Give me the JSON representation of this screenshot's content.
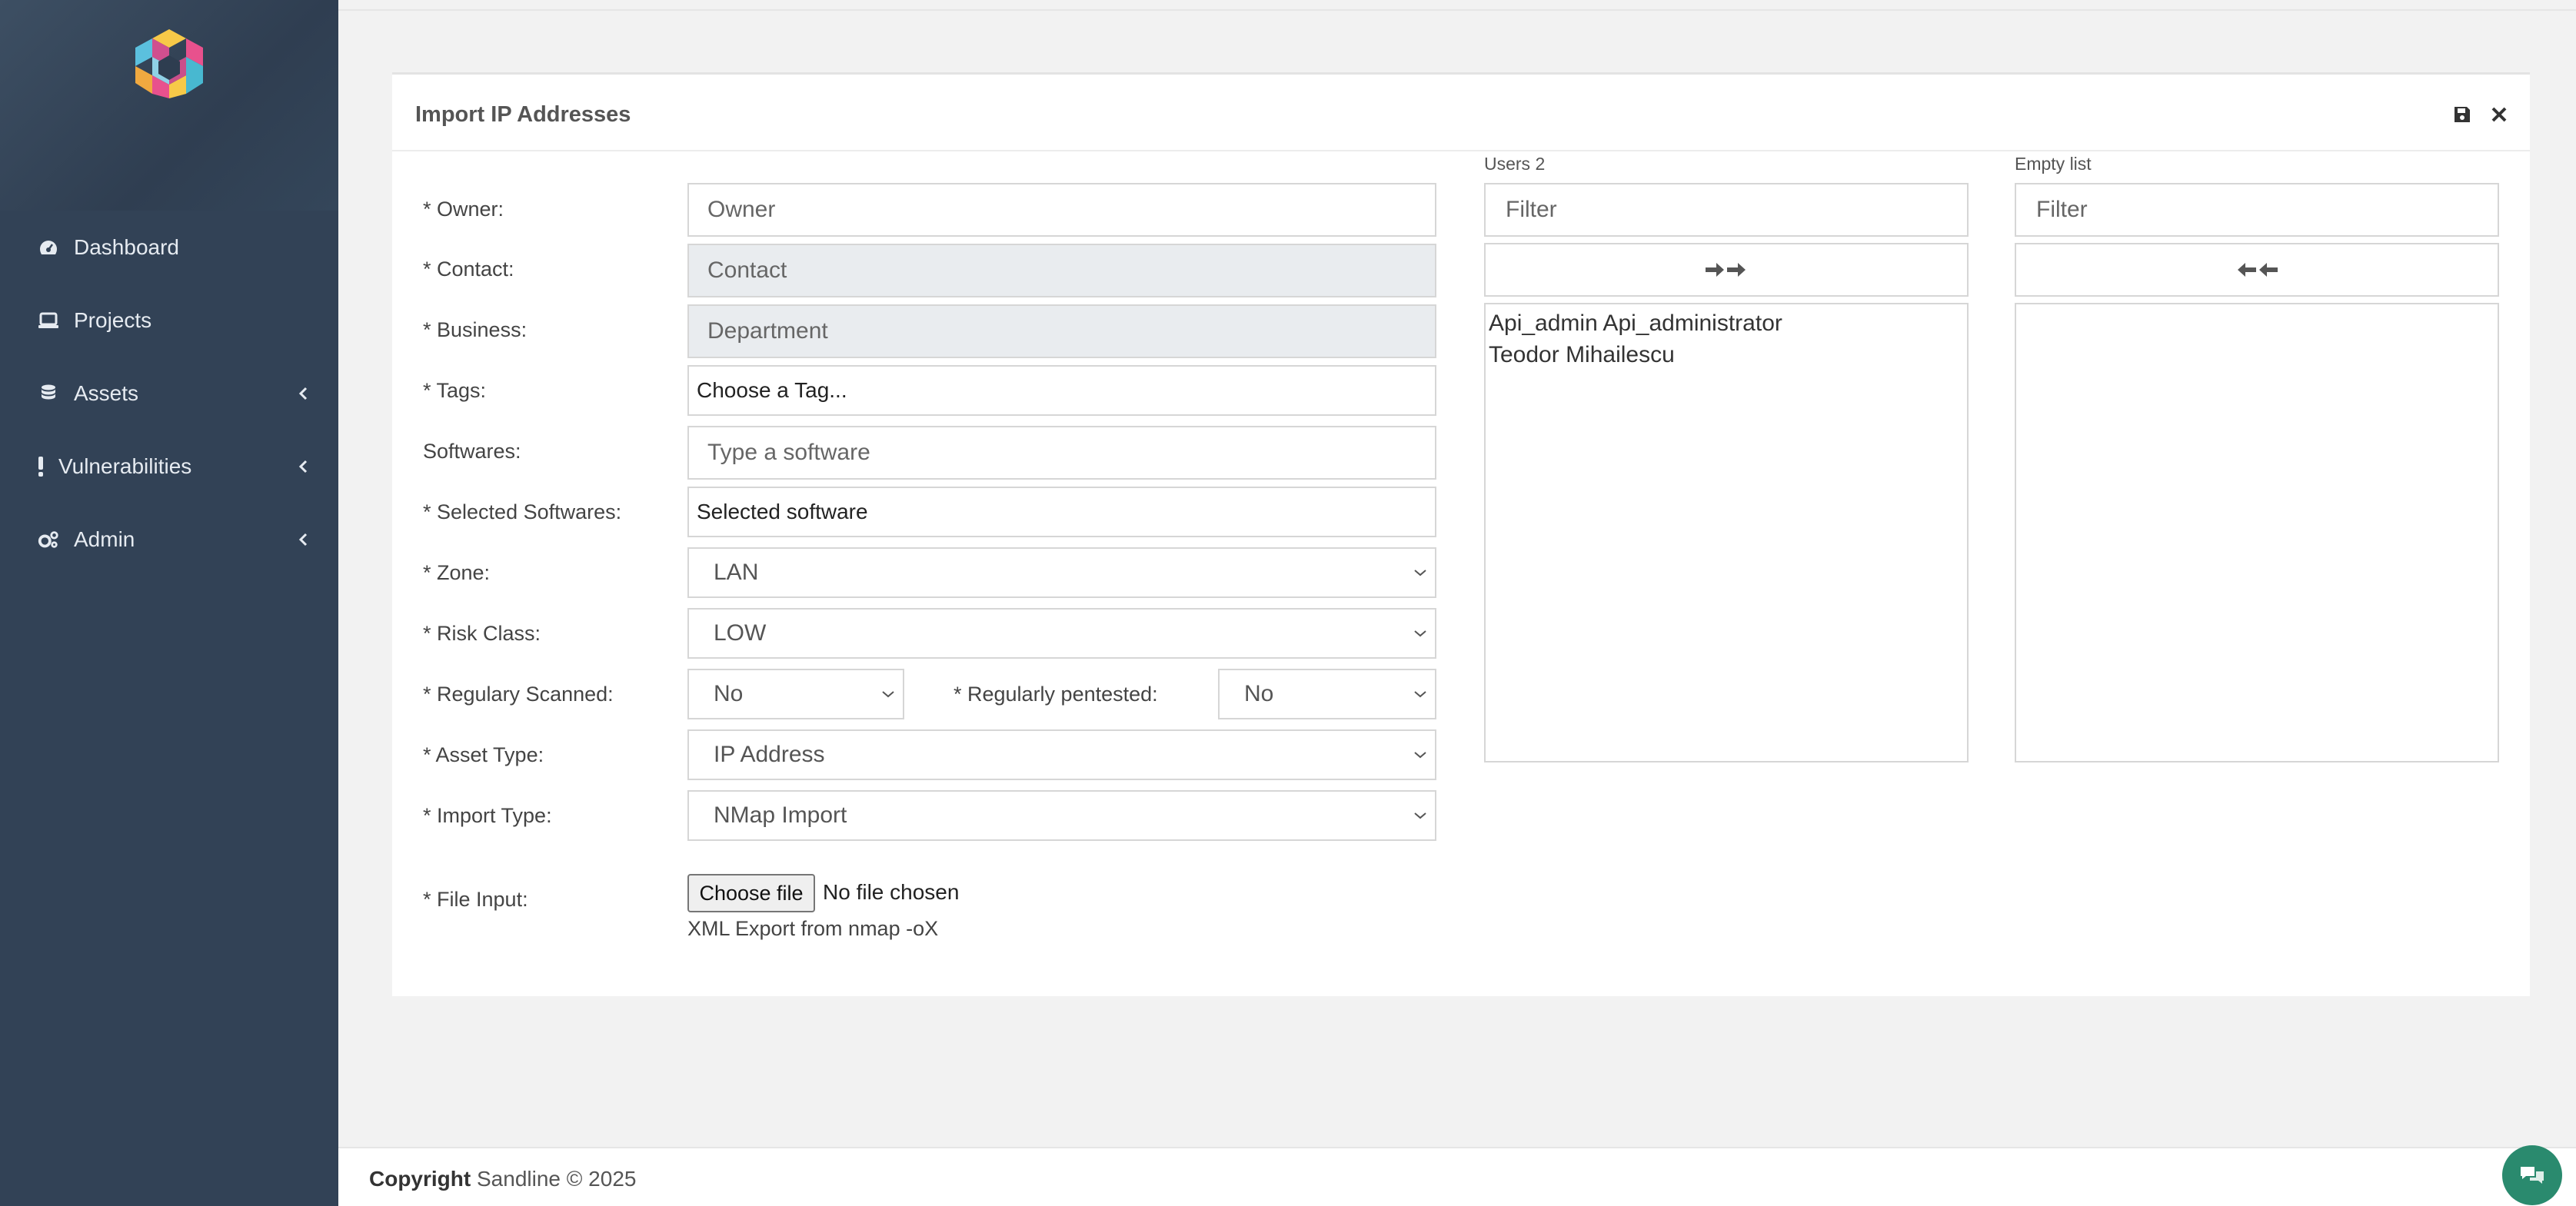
{
  "sidebar": {
    "items": [
      {
        "label": "Dashboard",
        "icon": "dashboard-icon"
      },
      {
        "label": "Projects",
        "icon": "laptop-icon"
      },
      {
        "label": "Assets",
        "icon": "database-icon"
      },
      {
        "label": "Vulnerabilities",
        "icon": "exclamation-icon"
      },
      {
        "label": "Admin",
        "icon": "cogs-icon"
      }
    ]
  },
  "card": {
    "title": "Import IP Addresses",
    "save_icon": "save-icon",
    "close_icon": "close-icon"
  },
  "form": {
    "owner": {
      "label": "* Owner:",
      "placeholder": "Owner"
    },
    "contact": {
      "label": "* Contact:",
      "placeholder": "Contact"
    },
    "business": {
      "label": "* Business:",
      "placeholder": "Department"
    },
    "tags": {
      "label": "* Tags:",
      "placeholder": "Choose a Tag..."
    },
    "softwares": {
      "label": "Softwares:",
      "placeholder": "Type a software"
    },
    "selected_softwares": {
      "label": "* Selected Softwares:",
      "value": "Selected software"
    },
    "zone": {
      "label": "* Zone:",
      "value": "LAN"
    },
    "risk_class": {
      "label": "* Risk Class:",
      "value": "LOW"
    },
    "regularly_scanned": {
      "label": "* Regulary Scanned:",
      "value": "No"
    },
    "regularly_pentested": {
      "label": "* Regularly pentested:",
      "value": "No"
    },
    "asset_type": {
      "label": "* Asset Type:",
      "value": "IP Address"
    },
    "import_type": {
      "label": "* Import Type:",
      "value": "NMap Import"
    },
    "file_input": {
      "label": "* File Input:",
      "button": "Choose file",
      "status": "No file chosen",
      "help": "XML Export from nmap -oX"
    }
  },
  "dual_list": {
    "left": {
      "label": "Users 2",
      "filter_placeholder": "Filter",
      "items": [
        "Api_admin Api_administrator",
        "Teodor Mihailescu"
      ]
    },
    "right": {
      "label": "Empty list",
      "filter_placeholder": "Filter",
      "items": []
    }
  },
  "footer": {
    "copyright_bold": "Copyright",
    "text": "Sandline © 2025"
  },
  "colors": {
    "sidebar": "#324256",
    "chat": "#2a8a6e"
  }
}
